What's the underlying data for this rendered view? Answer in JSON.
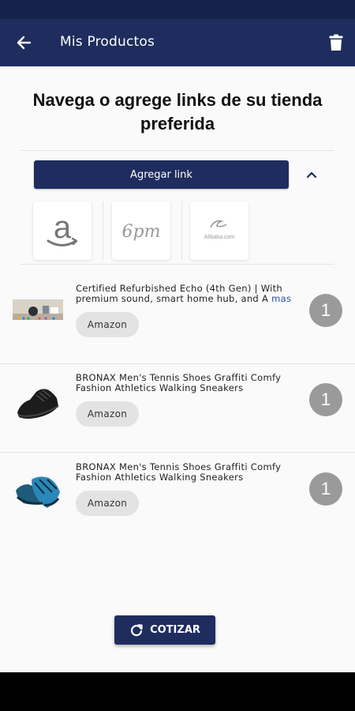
{
  "app_bar": {
    "title": "Mis Productos",
    "back_icon": "arrow-back-icon",
    "delete_icon": "trash-icon"
  },
  "heading": "Navega o agrege links de su tienda preferida",
  "add_link": {
    "label": "Agregar link",
    "collapse_icon": "chevron-up-icon"
  },
  "stores": [
    {
      "name": "amazon",
      "logo_text": "a"
    },
    {
      "name": "6pm",
      "logo_text": "6pm"
    },
    {
      "name": "alibaba",
      "logo_text": "Alibaba.com"
    }
  ],
  "products": [
    {
      "name": "Certified Refurbished Echo (4th Gen) | With premium sound, smart home hub, and A",
      "more": "mas",
      "store": "Amazon",
      "quantity": "1",
      "thumb": "echo-speaker-image"
    },
    {
      "name": "BRONAX Men's Tennis Shoes Graffiti Comfy Fashion Athletics Walking Sneakers",
      "more": "",
      "store": "Amazon",
      "quantity": "1",
      "thumb": "black-sneaker-image"
    },
    {
      "name": "BRONAX Men's Tennis Shoes Graffiti Comfy Fashion Athletics Walking Sneakers",
      "more": "",
      "store": "Amazon",
      "quantity": "1",
      "thumb": "blue-sneaker-image"
    }
  ],
  "cotizar": {
    "label": "COTIZAR",
    "icon": "refresh-icon"
  },
  "colors": {
    "primary": "#1f2d5e",
    "status_bar": "#15224a",
    "chip": "#e3e3e3",
    "quantity_badge": "#9a9a9a"
  }
}
